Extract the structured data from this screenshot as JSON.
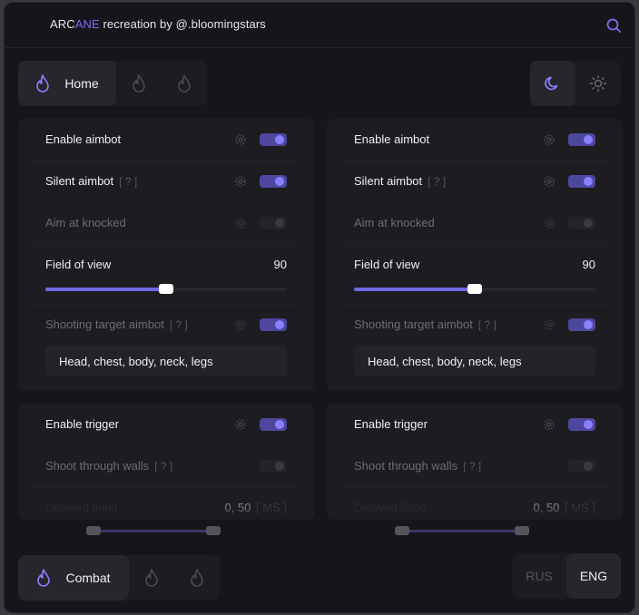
{
  "app": {
    "title_prefix": "ARC",
    "title_accent": "ANE",
    "title_suffix": " recreation by @.bloomingstars",
    "accent_color": "#7a6cf0"
  },
  "top_nav": {
    "active_label": "Home",
    "icons": [
      "flame-icon",
      "flame-icon",
      "flame-icon"
    ]
  },
  "theme": {
    "options": [
      "moon-icon",
      "sun-icon"
    ],
    "active": "moon"
  },
  "aimbot_panels": [
    {
      "enable_aimbot": "Enable aimbot",
      "silent_aimbot": "Silent aimbot",
      "silent_hint": "[ ? ]",
      "aim_knocked": "Aim at knocked",
      "fov_label": "Field of view",
      "fov_value": "90",
      "fov_fraction": 0.5,
      "shooting_target": "Shooting target aimbot",
      "shooting_hint": "[ ? ]",
      "target_parts": "Head, chest, body, neck, legs"
    },
    {
      "enable_aimbot": "Enable aimbot",
      "silent_aimbot": "Silent aimbot",
      "silent_hint": "[ ? ]",
      "aim_knocked": "Aim at knocked",
      "fov_label": "Field of view",
      "fov_value": "90",
      "fov_fraction": 0.5,
      "shooting_target": "Shooting target aimbot",
      "shooting_hint": "[ ? ]",
      "target_parts": "Head, chest, body, neck, legs"
    }
  ],
  "trigger_panels": [
    {
      "enable_trigger": "Enable trigger",
      "shoot_walls": "Shoot through walls",
      "walls_hint": "[ ? ]",
      "delayed_firing": "Delayed firing",
      "delay_value": "0, 50",
      "delay_unit": "[ MS ]"
    },
    {
      "enable_trigger": "Enable trigger",
      "shoot_walls": "Shoot through walls",
      "walls_hint": "[ ? ]",
      "delayed_firing": "Delayed firing",
      "delay_value": "0, 50",
      "delay_unit": "[ MS ]"
    }
  ],
  "bottom_nav": {
    "active_label": "Combat"
  },
  "language": {
    "options": [
      "RUS",
      "ENG"
    ],
    "active": "ENG"
  }
}
